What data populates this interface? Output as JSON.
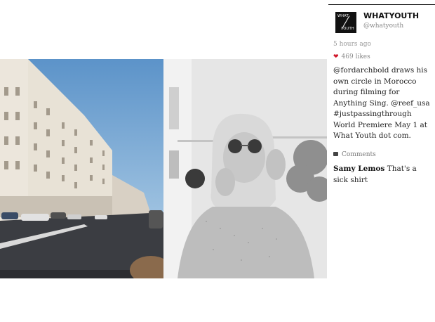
{
  "account": {
    "name": "WHATYOUTH",
    "handle": "@whatyouth",
    "logo_text_top": "WHAT",
    "logo_text_bottom": "YOUTH"
  },
  "post": {
    "time": "5 hours ago",
    "likes": "469 likes",
    "caption": "@fordarchbold draws his own circle in Morocco during filming for Anything Sing. @reef_usa #justpassingthrough World Premiere May 1 at What Youth dot com."
  },
  "comments": {
    "header": "Comments",
    "items": [
      {
        "user": "Samy Lemos",
        "text": "That's a sick shirt"
      }
    ]
  },
  "icons": {
    "heart": "heart-icon",
    "comment": "comment-icon"
  },
  "colors": {
    "heart": "#d0172a",
    "logo_bg": "#111111"
  }
}
